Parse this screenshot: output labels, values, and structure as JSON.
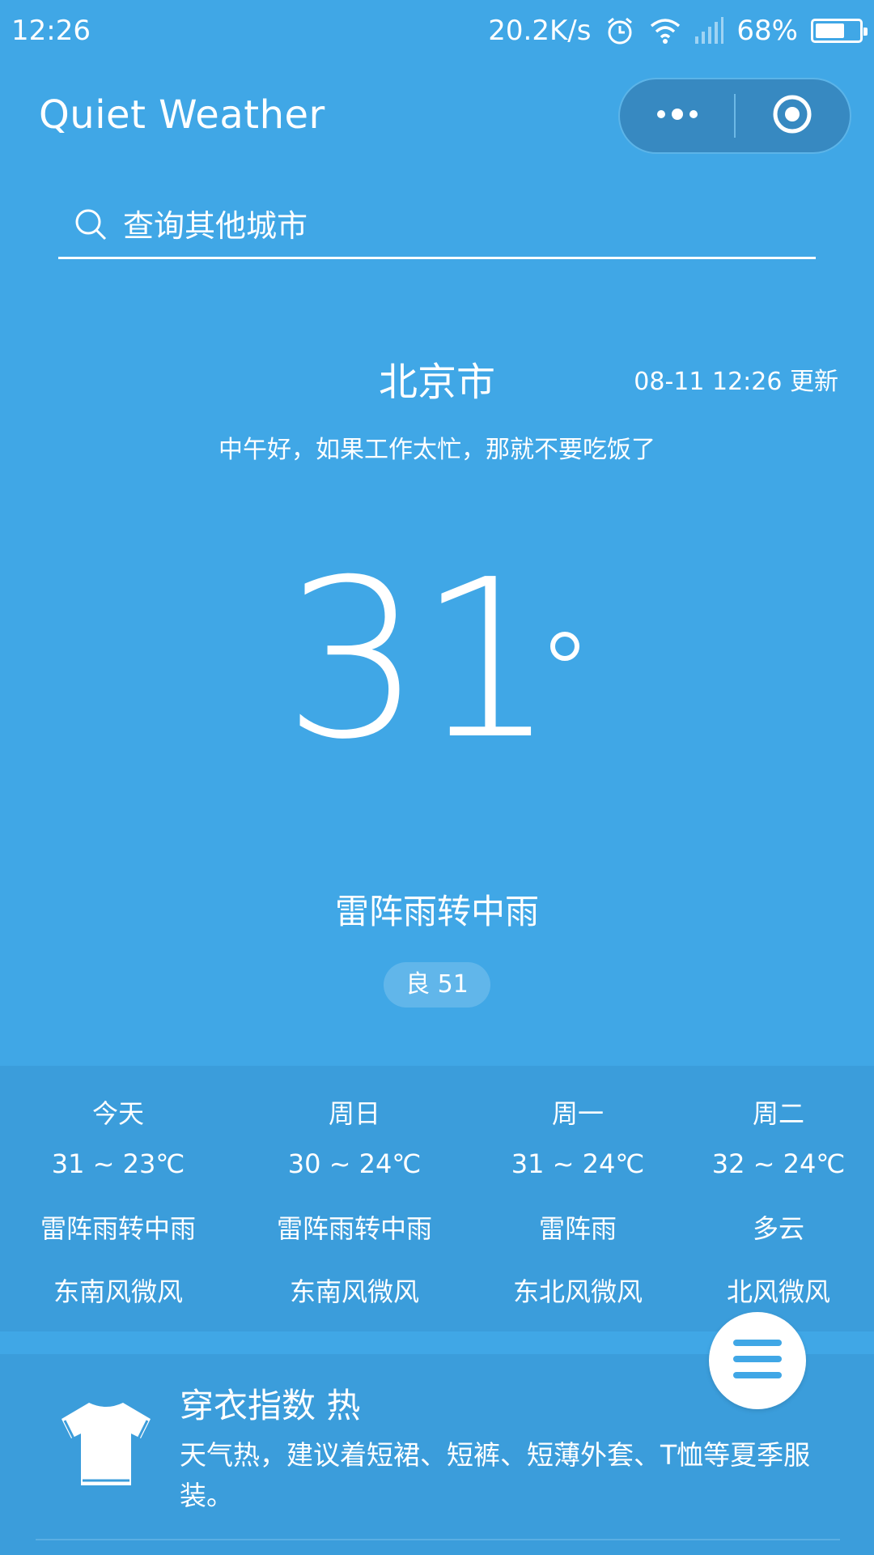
{
  "status_bar": {
    "time": "12:26",
    "net_speed": "20.2K/s",
    "battery_percent": "68%",
    "battery_level": 0.68
  },
  "app": {
    "title": "Quiet Weather"
  },
  "search": {
    "placeholder": "查询其他城市"
  },
  "current": {
    "city": "北京市",
    "updated": "08-11 12:26 更新",
    "greeting": "中午好，如果工作太忙，那就不要吃饭了",
    "temperature": "31",
    "condition": "雷阵雨转中雨",
    "aqi": "良 51"
  },
  "forecast": [
    {
      "day": "今天",
      "range": "31 ~ 23℃",
      "condition": "雷阵雨转中雨",
      "wind": "东南风微风"
    },
    {
      "day": "周日",
      "range": "30 ~ 24℃",
      "condition": "雷阵雨转中雨",
      "wind": "东南风微风"
    },
    {
      "day": "周一",
      "range": "31 ~ 24℃",
      "condition": "雷阵雨",
      "wind": "东北风微风"
    },
    {
      "day": "周二",
      "range": "32 ~ 24℃",
      "condition": "多云",
      "wind": "北风微风"
    }
  ],
  "clothing": {
    "title": "穿衣指数 热",
    "description": "天气热，建议着短裙、短裤、短薄外套、T恤等夏季服装。"
  },
  "colors": {
    "background": "#40a7e6",
    "card": "#3b9ddb",
    "capsule": "#3789c1",
    "text": "#ffffff"
  },
  "icons": {
    "status": [
      "alarm-icon",
      "wifi-icon",
      "signal-icon",
      "battery-icon"
    ],
    "capsule": [
      "more-icon",
      "close-mini-program-icon"
    ],
    "search": "search-icon",
    "clothing": "tshirt-icon",
    "fab": "menu-icon"
  }
}
